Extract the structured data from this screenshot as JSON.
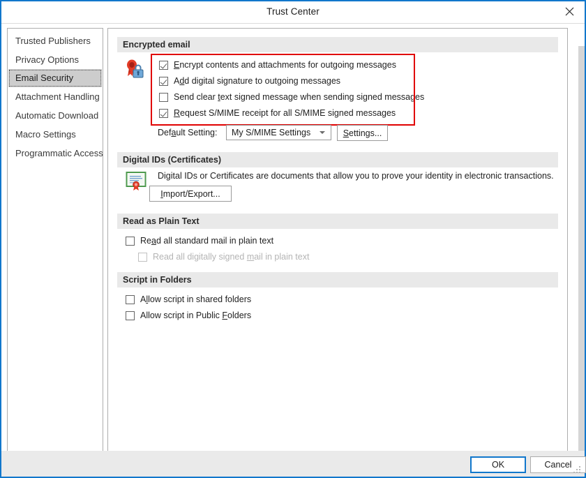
{
  "window": {
    "title": "Trust Center",
    "close_icon": "close-icon",
    "accent_color": "#1177cc"
  },
  "sidebar": {
    "items": [
      {
        "label": "Trusted Publishers",
        "selected": false
      },
      {
        "label": "Privacy Options",
        "selected": false
      },
      {
        "label": "Email Security",
        "selected": true
      },
      {
        "label": "Attachment Handling",
        "selected": false
      },
      {
        "label": "Automatic Download",
        "selected": false
      },
      {
        "label": "Macro Settings",
        "selected": false
      },
      {
        "label": "Programmatic Access",
        "selected": false
      }
    ]
  },
  "sections": {
    "encrypted_email": {
      "heading": "Encrypted email",
      "icon": "certificate-lock-icon",
      "highlight_color": "#e00000",
      "checkboxes": [
        {
          "label": "Encrypt contents and attachments for outgoing messages",
          "accel": "E",
          "checked": true,
          "enabled": true
        },
        {
          "label": "Add digital signature to outgoing messages",
          "accel": "d",
          "checked": true,
          "enabled": true
        },
        {
          "label": "Send clear text signed message when sending signed messages",
          "accel": "t",
          "checked": false,
          "enabled": true
        },
        {
          "label": "Request S/MIME receipt for all S/MIME signed messages",
          "accel": "R",
          "checked": true,
          "enabled": true
        }
      ],
      "default_setting_label": "Default Setting:",
      "default_setting_accel": "a",
      "default_setting_value": "My S/MIME Settings",
      "settings_button": "Settings...",
      "settings_button_accel": "S"
    },
    "digital_ids": {
      "heading": "Digital IDs (Certificates)",
      "icon": "certificate-document-icon",
      "description": "Digital IDs or Certificates are documents that allow you to prove your identity in electronic transactions.",
      "import_export_button": "Import/Export...",
      "import_export_accel": "I"
    },
    "read_as_plain_text": {
      "heading": "Read as Plain Text",
      "checkboxes": [
        {
          "label": "Read all standard mail in plain text",
          "accel": "a",
          "checked": false,
          "enabled": true
        },
        {
          "label": "Read all digitally signed mail in plain text",
          "accel": "m",
          "checked": false,
          "enabled": false
        }
      ]
    },
    "script_in_folders": {
      "heading": "Script in Folders",
      "checkboxes": [
        {
          "label": "Allow script in shared folders",
          "accel": "l",
          "checked": false,
          "enabled": true
        },
        {
          "label": "Allow script in Public Folders",
          "accel": "F",
          "checked": false,
          "enabled": true
        }
      ]
    }
  },
  "footer": {
    "ok_label": "OK",
    "cancel_label": "Cancel"
  }
}
